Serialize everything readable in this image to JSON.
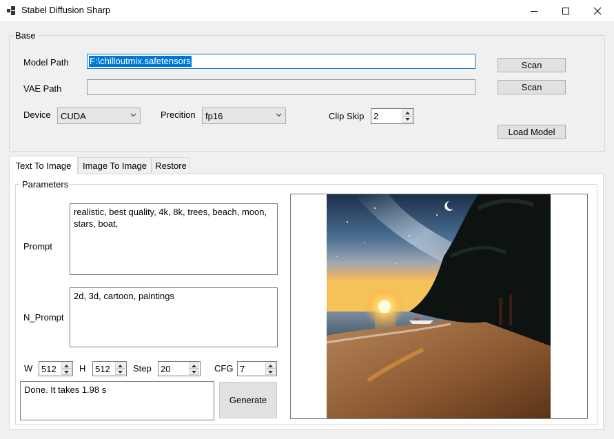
{
  "window": {
    "title": "Stabel Diffusion Sharp"
  },
  "base": {
    "legend": "Base",
    "model_path_label": "Model Path",
    "model_path_value": "F:\\chilloutmix.safetensors",
    "vae_path_label": "VAE Path",
    "vae_path_value": "",
    "scan_label_1": "Scan",
    "scan_label_2": "Scan",
    "device_label": "Device",
    "device_value": "CUDA",
    "precision_label": "Precition",
    "precision_value": "fp16",
    "clip_skip_label": "Clip Skip",
    "clip_skip_value": "2",
    "load_model_label": "Load Model"
  },
  "tabs": [
    {
      "label": "Text To Image",
      "active": true
    },
    {
      "label": "Image To Image",
      "active": false
    },
    {
      "label": "Restore",
      "active": false
    }
  ],
  "parameters": {
    "legend": "Parameters",
    "prompt_label": "Prompt",
    "prompt_value": "realistic, best quality, 4k, 8k, trees, beach, moon, stars, boat,",
    "nprompt_label": "N_Prompt",
    "nprompt_value": "2d, 3d, cartoon, paintings",
    "w_label": "W",
    "w_value": "512",
    "h_label": "H",
    "h_value": "512",
    "step_label": "Step",
    "step_value": "20",
    "cfg_label": "CFG",
    "cfg_value": "7",
    "status_text": "Done. It takes 1.98 s",
    "generate_label": "Generate"
  },
  "colors": {
    "selection": "#0078d7",
    "window_bg": "#f0f0f0",
    "button_bg": "#e1e1e1"
  }
}
